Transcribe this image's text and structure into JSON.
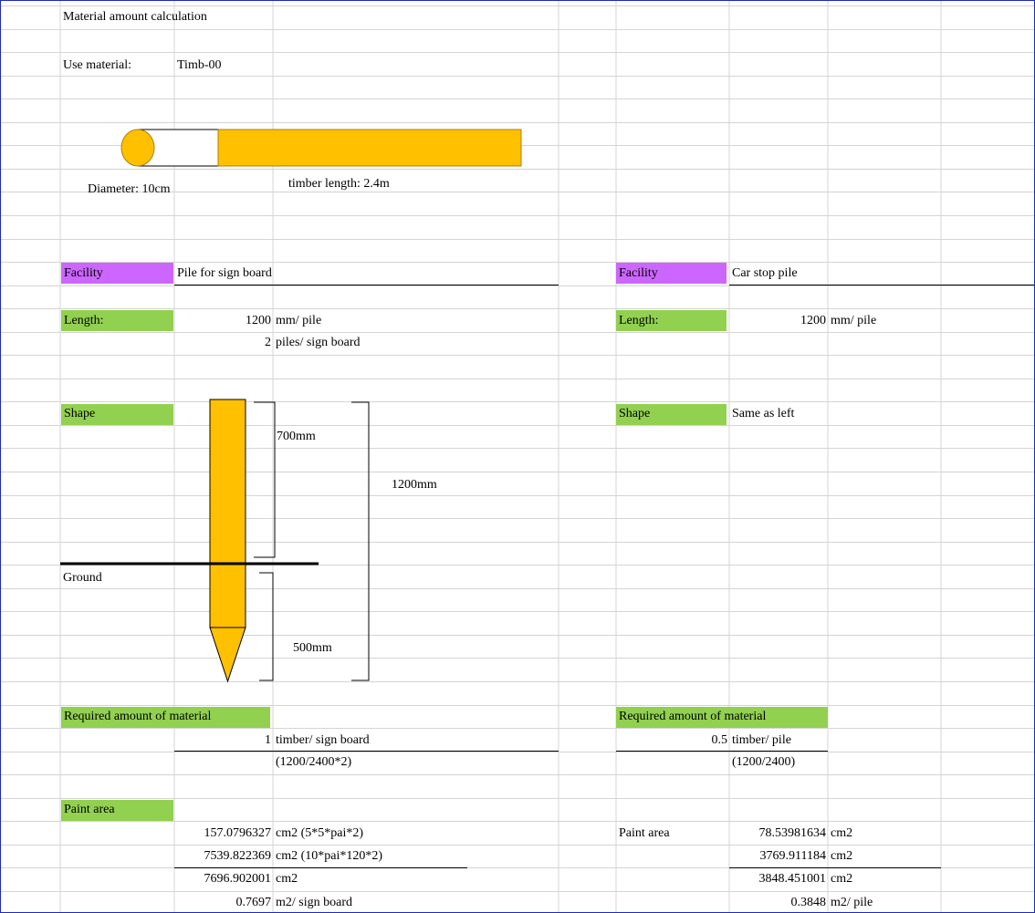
{
  "title": "Material amount calculation",
  "use_material": {
    "label": "Use material:",
    "value": "Timb-00"
  },
  "timber_diagram": {
    "diameter_label": "Diameter: 10cm",
    "length_label": "timber length: 2.4m"
  },
  "colors": {
    "timber": "#ffc000",
    "facility_tag": "#cc66ff",
    "label_tag": "#92d050",
    "gridline": "#d4d4d4"
  },
  "left": {
    "facility_label": "Facility",
    "facility_value": "Pile for sign board",
    "length_label": "Length:",
    "length_value": "1200",
    "length_unit": "mm/ pile",
    "piles_value": "2",
    "piles_unit": "piles/ sign board",
    "shape_label": "Shape",
    "dim_700": "700mm",
    "dim_1200": "1200mm",
    "dim_500": "500mm",
    "ground_label": "Ground",
    "required_label": "Required amount of material",
    "required_value": "1",
    "required_unit": "timber/ sign board",
    "required_formula": "(1200/2400*2)",
    "paint_label": "Paint area",
    "paint_rows": [
      {
        "value": "157.0796327",
        "unit": "cm2 (5*5*pai*2)"
      },
      {
        "value": "7539.822369",
        "unit": "cm2 (10*pai*120*2)"
      },
      {
        "value": "7696.902001",
        "unit": "cm2"
      },
      {
        "value": "0.7697",
        "unit": "m2/ sign board"
      }
    ]
  },
  "right": {
    "facility_label": "Facility",
    "facility_value": "Car stop pile",
    "length_label": "Length:",
    "length_value": "1200",
    "length_unit": "mm/ pile",
    "shape_label": "Shape",
    "shape_value": "Same as left",
    "required_label": "Required amount of material",
    "required_value": "0.5",
    "required_unit": "timber/ pile",
    "required_formula": "(1200/2400)",
    "paint_label": "Paint area",
    "paint_rows": [
      {
        "value": "78.53981634",
        "unit": "cm2"
      },
      {
        "value": "3769.911184",
        "unit": "cm2"
      },
      {
        "value": "3848.451001",
        "unit": "cm2"
      },
      {
        "value": "0.3848",
        "unit": "m2/ pile"
      }
    ]
  }
}
